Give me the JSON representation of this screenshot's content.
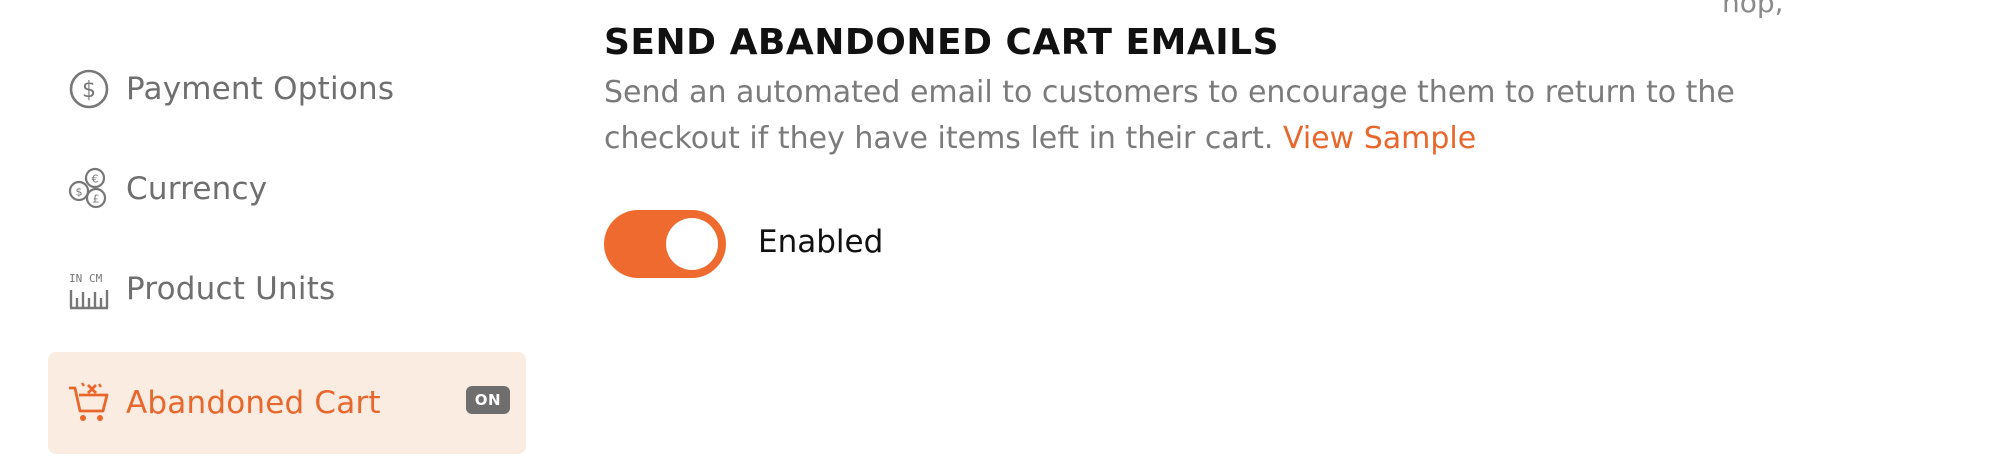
{
  "sidebar": {
    "items": [
      {
        "label": "Payment Options",
        "icon": "dollar-circle-icon"
      },
      {
        "label": "Currency",
        "icon": "currency-coins-icon"
      },
      {
        "label": "Product Units",
        "icon": "ruler-units-icon"
      },
      {
        "label": "Abandoned Cart",
        "icon": "cart-x-icon",
        "active": true,
        "badge": "ON"
      }
    ]
  },
  "section": {
    "title": "SEND ABANDONED CART EMAILS",
    "description": "Send an automated email to customers to encourage them to return to the checkout if they have items left in their cart.",
    "link": "View Sample"
  },
  "toggle": {
    "state": "on",
    "label": "Enabled"
  },
  "partial_text": "nop,",
  "colors": {
    "accent": "#e8672c",
    "active_bg": "#faece0",
    "muted_text": "#6f6f6f",
    "badge_bg": "#6e6e6e"
  }
}
